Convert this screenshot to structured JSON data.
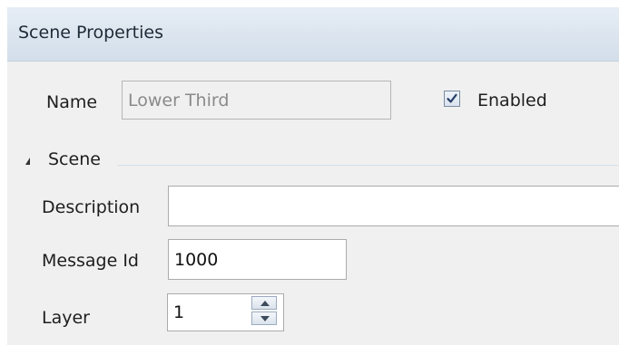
{
  "panel": {
    "title": "Scene Properties"
  },
  "name_row": {
    "label": "Name",
    "value": "Lower Third",
    "enabled_label": "Enabled",
    "enabled_checked": true
  },
  "scene_group": {
    "label": "Scene"
  },
  "fields": {
    "description": {
      "label": "Description",
      "value": ""
    },
    "message_id": {
      "label": "Message Id",
      "value": "1000"
    },
    "layer": {
      "label": "Layer",
      "value": "1"
    }
  }
}
